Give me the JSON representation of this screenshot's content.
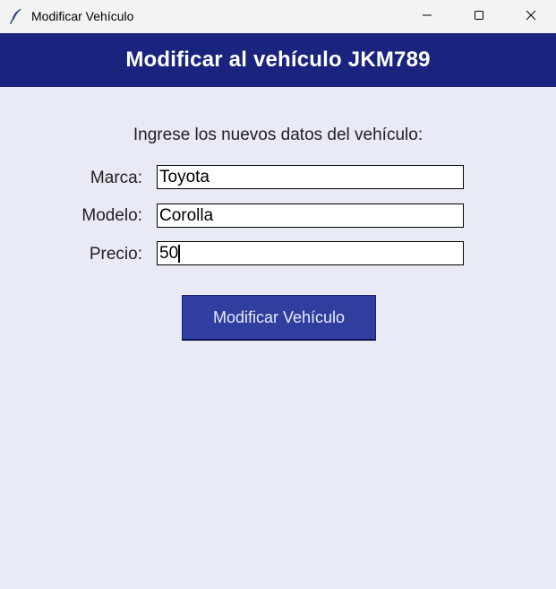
{
  "window": {
    "title": "Modificar Vehículo",
    "icon": "feather-icon",
    "controls": {
      "minimize_icon": "minimize-icon",
      "maximize_icon": "maximize-icon",
      "close_icon": "close-icon"
    }
  },
  "header": {
    "title": "Modificar al vehículo JKM789",
    "background": "#1a237e",
    "color": "#ffffff"
  },
  "form": {
    "instruction": "Ingrese los nuevos datos del vehículo:",
    "fields": {
      "marca": {
        "label": "Marca:",
        "value": "Toyota"
      },
      "modelo": {
        "label": "Modelo:",
        "value": "Corolla"
      },
      "precio": {
        "label": "Precio:",
        "value": "50"
      }
    },
    "focused_field": "precio",
    "submit_label": "Modificar Vehículo",
    "submit_color": "#303f9f"
  },
  "colors": {
    "background": "#e8eaf6",
    "titlebar": "#f3f3f3"
  }
}
